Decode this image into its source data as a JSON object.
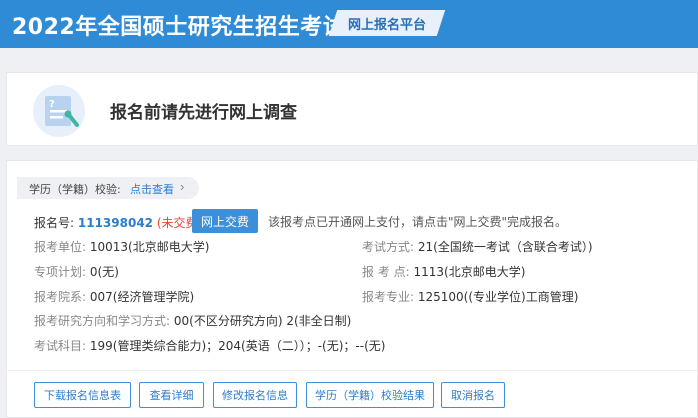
{
  "header": {
    "title": "2022年全国硕士研究生招生考试",
    "badge": "网上报名平台"
  },
  "survey": {
    "icon": "questionnaire-icon",
    "text": "报名前请先进行网上调查"
  },
  "verify": {
    "label": "学历（学籍）校验:",
    "link": "点击查看",
    "chevron": "›"
  },
  "registration": {
    "label": "报名号:",
    "number": "111398042",
    "status": "(未交费)",
    "pay_button": "网上交费",
    "tip": "该报考点已开通网上支付，请点击\"网上交费\"完成报名。"
  },
  "fields": {
    "unit_label": "报考单位:",
    "unit_value": "10013(北京邮电大学)",
    "exam_method_label": "考试方式:",
    "exam_method_value": "21(全国统一考试（含联合考试）)",
    "special_plan_label": "专项计划:",
    "special_plan_value": "0(无)",
    "exam_site_label": "报 考 点:",
    "exam_site_value": "1113(北京邮电大学)",
    "department_label": "报考院系:",
    "department_value": "007(经济管理学院)",
    "major_label": "报考专业:",
    "major_value": "125100((专业学位)工商管理)",
    "direction_label": "报考研究方向和学习方式:",
    "direction_value": "00(不区分研究方向) 2(非全日制)",
    "subjects_label": "考试科目:",
    "subjects_value": "199(管理类综合能力)；204(英语（二））；-(无)；--(无)"
  },
  "actions": {
    "download": "下载报名信息表",
    "details": "查看详细",
    "modify": "修改报名信息",
    "verify_result": "学历（学籍）校验结果",
    "cancel": "取消报名"
  }
}
